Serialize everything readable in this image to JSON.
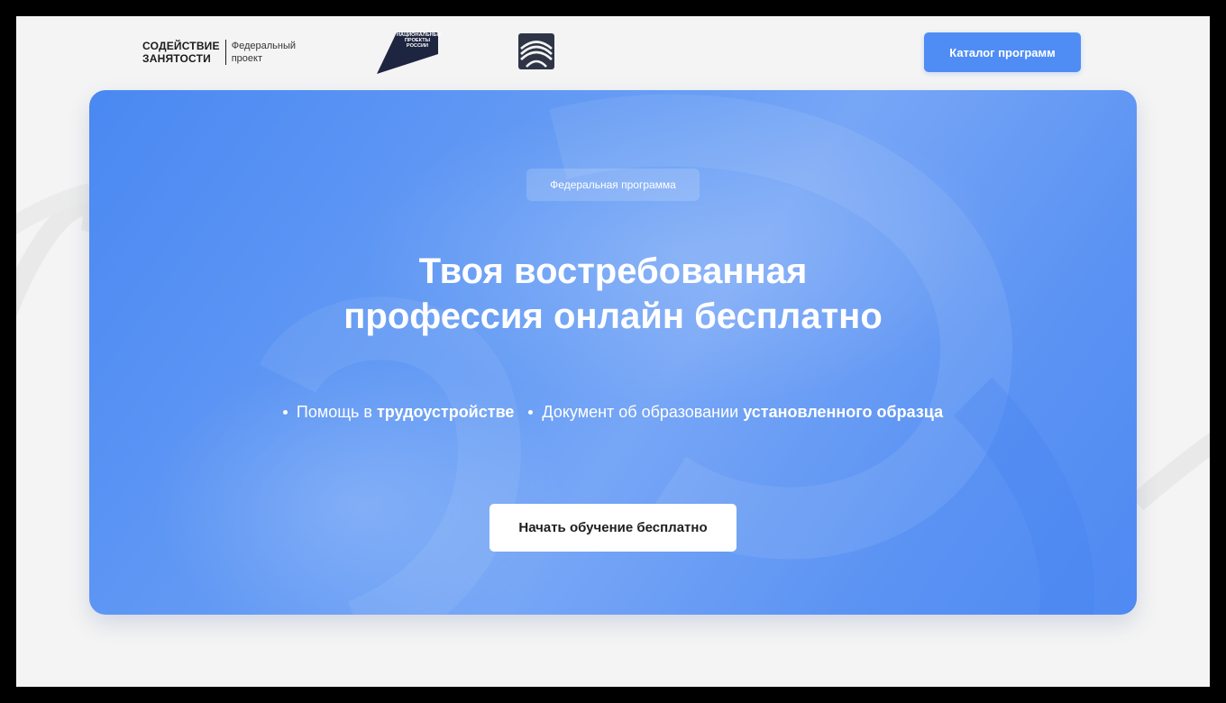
{
  "header": {
    "logo_szan": {
      "line1": "СОДЕЙСТВИЕ",
      "line2": "ЗАНЯТОСТИ",
      "sub1": "Федеральный",
      "sub2": "проект"
    },
    "logo_np": {
      "line1": "НАЦИОНАЛЬНЫЕ",
      "line2": "ПРОЕКТЫ",
      "line3": "РОССИИ"
    },
    "catalog_label": "Каталог программ"
  },
  "hero": {
    "badge": "Федеральная программа",
    "title_line1": "Твоя востребованная",
    "title_line2": "профессия онлайн бесплатно",
    "bullets": [
      {
        "text": "Помощь в",
        "bold": "трудоустройстве"
      },
      {
        "text": "Документ об образовании",
        "bold": "установленного образца"
      }
    ],
    "cta_label": "Начать обучение бесплатно"
  },
  "colors": {
    "accent": "#4f8df4",
    "page_bg": "#f4f4f4",
    "frame": "#000000",
    "hero_text": "#ffffff"
  }
}
